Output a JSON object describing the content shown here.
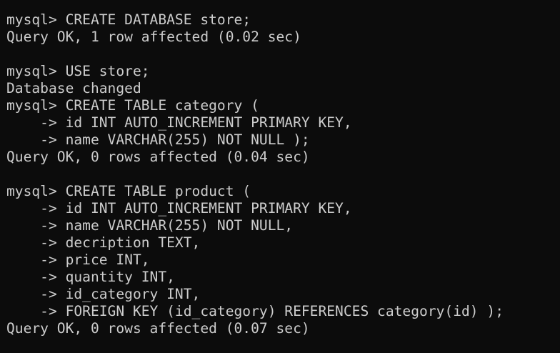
{
  "terminal": {
    "lines": [
      "mysql> CREATE DATABASE store;",
      "Query OK, 1 row affected (0.02 sec)",
      "",
      "mysql> USE store;",
      "Database changed",
      "mysql> CREATE TABLE category (",
      "    -> id INT AUTO_INCREMENT PRIMARY KEY,",
      "    -> name VARCHAR(255) NOT NULL );",
      "Query OK, 0 rows affected (0.04 sec)",
      "",
      "mysql> CREATE TABLE product (",
      "    -> id INT AUTO_INCREMENT PRIMARY KEY,",
      "    -> name VARCHAR(255) NOT NULL,",
      "    -> decription TEXT,",
      "    -> price INT,",
      "    -> quantity INT,",
      "    -> id_category INT,",
      "    -> FOREIGN KEY (id_category) REFERENCES category(id) );",
      "Query OK, 0 rows affected (0.07 sec)"
    ],
    "colors": {
      "background": "#0c0c0c",
      "text": "#cccccc"
    }
  }
}
